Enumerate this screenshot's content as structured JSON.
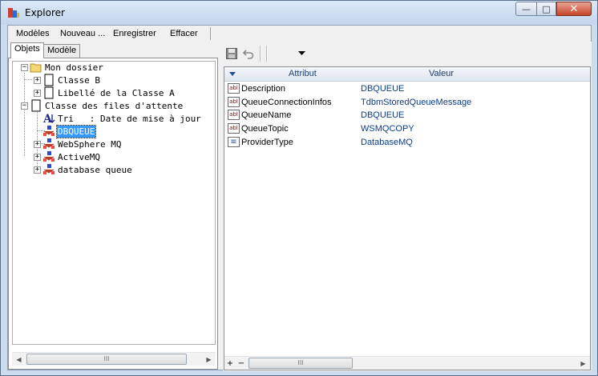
{
  "window": {
    "title": "Explorer"
  },
  "window_buttons": {
    "minimize": "—",
    "maximize": "□",
    "close": "✕"
  },
  "menu": [
    "Modèles",
    "Nouveau ...",
    "Enregistrer",
    "Effacer"
  ],
  "tabs": [
    {
      "label": "Objets",
      "active": true
    },
    {
      "label": "Modèle",
      "active": false
    }
  ],
  "tree": {
    "root": "Mon dossier",
    "classe_b": "Classe B",
    "libelle": "Libellé de la Classe A",
    "files": "Classe des files d'attente",
    "tri": "Tri   : Date de mise à jour",
    "dbqueue": "DBQUEUE",
    "websphere": "WebSphere MQ",
    "activemq": "ActiveMQ",
    "database": "database queue"
  },
  "scroll_grip": "III",
  "grid": {
    "columns": [
      "Attribut",
      "Valeur"
    ],
    "rows": [
      {
        "name": "Description",
        "value": "DBQUEUE",
        "icon": "text-field-icon",
        "icon_text": "abl"
      },
      {
        "name": "QueueConnectionInfos",
        "value": "TdbmStoredQueueMessage",
        "icon": "text-field-icon",
        "icon_text": "abl"
      },
      {
        "name": "QueueName",
        "value": "DBQUEUE",
        "icon": "text-field-icon",
        "icon_text": "abl"
      },
      {
        "name": "QueueTopic",
        "value": "WSMQCOPY",
        "icon": "text-field-icon",
        "icon_text": "abl"
      },
      {
        "name": "ProviderType",
        "value": "DatabaseMQ",
        "icon": "list-field-icon",
        "icon_text": "≡"
      }
    ]
  },
  "grid_footer": {
    "add": "+",
    "remove": "−"
  },
  "colors": {
    "selection": "#3399ff",
    "value_text": "#0a3c8a",
    "title_bar": "#c3d6ec"
  }
}
